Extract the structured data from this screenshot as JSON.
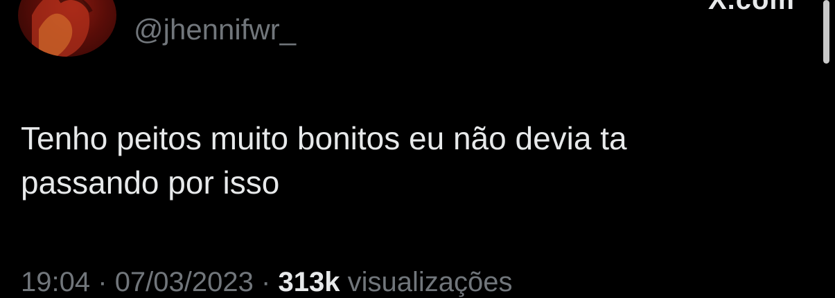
{
  "profile": {
    "handle": "@jhennifwr_",
    "avatar_icon": "profile-avatar-image"
  },
  "header": {
    "cut_text": "X.com"
  },
  "tweet": {
    "text_line1": "Tenho peitos muito bonitos eu não devia ta",
    "text_line2": "passando por isso"
  },
  "meta": {
    "time": "19:04",
    "date": "07/03/2023",
    "separator": "·",
    "views_count": "313k",
    "views_label": "visualizações"
  },
  "colors": {
    "background": "#000000",
    "primary_text": "#e7e9ea",
    "secondary_text": "#71767b"
  }
}
